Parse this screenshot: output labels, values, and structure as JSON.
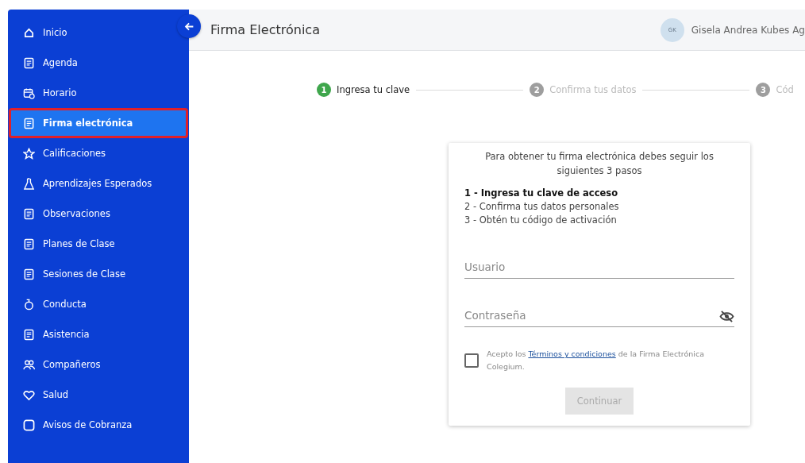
{
  "sidebar": {
    "items": [
      {
        "label": "Inicio",
        "selected": false
      },
      {
        "label": "Agenda",
        "selected": false
      },
      {
        "label": "Horario",
        "selected": false
      },
      {
        "label": "Firma electrónica",
        "selected": true
      },
      {
        "label": "Calificaciones",
        "selected": false
      },
      {
        "label": "Aprendizajes Esperados",
        "selected": false
      },
      {
        "label": "Observaciones",
        "selected": false
      },
      {
        "label": "Planes de Clase",
        "selected": false
      },
      {
        "label": "Sesiones de Clase",
        "selected": false
      },
      {
        "label": "Conducta",
        "selected": false
      },
      {
        "label": "Asistencia",
        "selected": false
      },
      {
        "label": "Compañeros",
        "selected": false
      },
      {
        "label": "Salud",
        "selected": false
      },
      {
        "label": "Avisos de Cobranza",
        "selected": false
      }
    ]
  },
  "header": {
    "title": "Firma Electrónica",
    "avatar": "GK",
    "user": "Gisela Andrea Kubes Ag"
  },
  "stepper": [
    {
      "number": "1",
      "label": "Ingresa tu clave",
      "selected": true
    },
    {
      "number": "2",
      "label": "Confirma tus datos",
      "selected": false
    },
    {
      "number": "3",
      "label": "Cód",
      "selected": false
    }
  ],
  "card": {
    "intro": "Para obtener tu firma electrónica debes seguir los siguientes 3 pasos",
    "steps": [
      {
        "text": "1 - Ingresa tu clave de acceso",
        "selected": true
      },
      {
        "text": "2 - Confirma tus datos personales",
        "selected": false
      },
      {
        "text": "3 - Obtén tu código de activación",
        "selected": false
      }
    ],
    "username": {
      "placeholder": "Usuario"
    },
    "password": {
      "placeholder": "Contraseña"
    },
    "terms": {
      "checked": false,
      "before": "Acepto los",
      "link": "Términos y condiciones",
      "after": "de la Firma Electrónica Colegium."
    },
    "button": {
      "label": "Continuar",
      "disabled": true
    }
  }
}
